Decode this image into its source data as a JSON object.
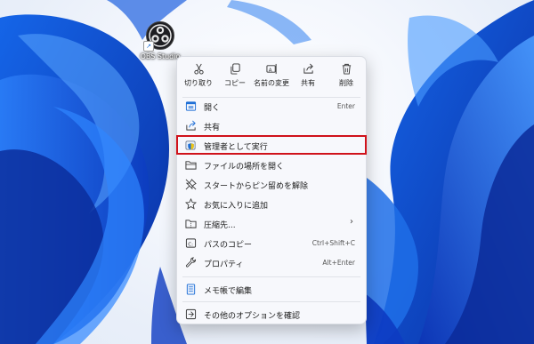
{
  "desktop": {
    "icon_label": "OBS Studio",
    "accent": "#1f6fd6"
  },
  "context_menu": {
    "quick_actions": [
      {
        "label": "切り取り",
        "icon": "scissors-icon"
      },
      {
        "label": "コピー",
        "icon": "copy-icon"
      },
      {
        "label": "名前の変更",
        "icon": "rename-icon"
      },
      {
        "label": "共有",
        "icon": "share-icon"
      },
      {
        "label": "削除",
        "icon": "trash-icon"
      }
    ],
    "items": [
      {
        "label": "開く",
        "shortcut": "Enter",
        "icon": "open-icon"
      },
      {
        "label": "共有",
        "shortcut": "",
        "icon": "share-icon"
      },
      {
        "label": "管理者として実行",
        "shortcut": "",
        "icon": "shield-icon",
        "highlighted": true
      },
      {
        "label": "ファイルの場所を開く",
        "shortcut": "",
        "icon": "folder-icon"
      },
      {
        "label": "スタートからピン留めを解除",
        "shortcut": "",
        "icon": "unpin-icon"
      },
      {
        "label": "お気に入りに追加",
        "shortcut": "",
        "icon": "star-icon"
      },
      {
        "label": "圧縮先...",
        "shortcut": "",
        "icon": "zip-folder-icon",
        "submenu": true
      },
      {
        "label": "パスのコピー",
        "shortcut": "Ctrl+Shift+C",
        "icon": "copy-path-icon"
      },
      {
        "label": "プロパティ",
        "shortcut": "Alt+Enter",
        "icon": "wrench-icon"
      },
      {
        "label": "メモ帳で編集",
        "shortcut": "",
        "icon": "notepad-icon"
      },
      {
        "label": "その他のオプションを確認",
        "shortcut": "",
        "icon": "more-options-icon"
      }
    ],
    "highlight_color": "#d0121b"
  }
}
